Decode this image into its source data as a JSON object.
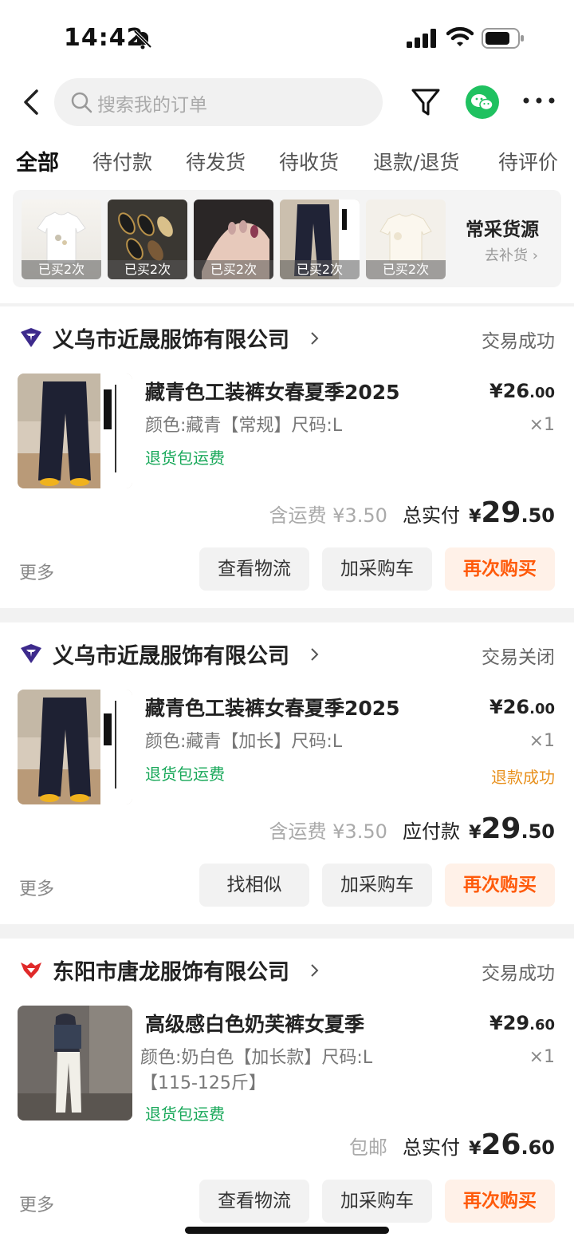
{
  "status_bar": {
    "time": "14:42"
  },
  "search": {
    "placeholder": "搜索我的订单"
  },
  "tabs": [
    "全部",
    "待付款",
    "待发货",
    "待收货",
    "退款/退货",
    "待评价"
  ],
  "recent": {
    "items": [
      {
        "caption": "已买2次",
        "icon": "white-tshirt"
      },
      {
        "caption": "已买2次",
        "icon": "nails-black-gold"
      },
      {
        "caption": "已买2次",
        "icon": "nails-pink"
      },
      {
        "caption": "已买2次",
        "icon": "navy-pants"
      },
      {
        "caption": "已买2次",
        "icon": "cream-top"
      }
    ],
    "title": "常采货源",
    "subtitle": "去补货"
  },
  "orders": [
    {
      "shop": "义乌市近晟服饰有限公司",
      "status": "交易成功",
      "title": "藏青色工装裤女春夏季2025",
      "spec": "颜色:藏青【常规】尺码:L",
      "free_return": "退货包运费",
      "price_int": "¥26",
      "price_dec": ".00",
      "qty": "×1",
      "refund": "",
      "shipping": "含运费 ¥3.50",
      "total_label": "总实付",
      "total_cur": "¥",
      "total_int": "29",
      "total_dec": ".50",
      "more": "更多",
      "btn1": "查看物流",
      "btn2": "加采购车",
      "btn3": "再次购买"
    },
    {
      "shop": "义乌市近晟服饰有限公司",
      "status": "交易关闭",
      "title": "藏青色工装裤女春夏季2025",
      "spec": "颜色:藏青【加长】尺码:L",
      "free_return": "退货包运费",
      "price_int": "¥26",
      "price_dec": ".00",
      "qty": "×1",
      "refund": "退款成功",
      "shipping": "含运费 ¥3.50",
      "total_label": "应付款",
      "total_cur": "¥",
      "total_int": "29",
      "total_dec": ".50",
      "more": "更多",
      "btn1": "找相似",
      "btn2": "加采购车",
      "btn3": "再次购买"
    },
    {
      "shop": "东阳市唐龙服饰有限公司",
      "status": "交易成功",
      "title": "高级感白色奶芙裤女夏季",
      "spec": "颜色:奶白色【加长款】尺码:L【115-125斤】",
      "free_return": "退货包运费",
      "price_int": "¥29",
      "price_dec": ".60",
      "qty": "×1",
      "refund": "",
      "shipping": "包邮",
      "total_label": "总实付",
      "total_cur": "¥",
      "total_int": "26",
      "total_dec": ".60",
      "more": "更多",
      "btn1": "查看物流",
      "btn2": "加采购车",
      "btn3": "再次购买"
    }
  ],
  "colors": {
    "accent": "#ff5a0a",
    "green": "#19a85a",
    "wechat": "#1fc160",
    "refund": "#e8911e"
  }
}
